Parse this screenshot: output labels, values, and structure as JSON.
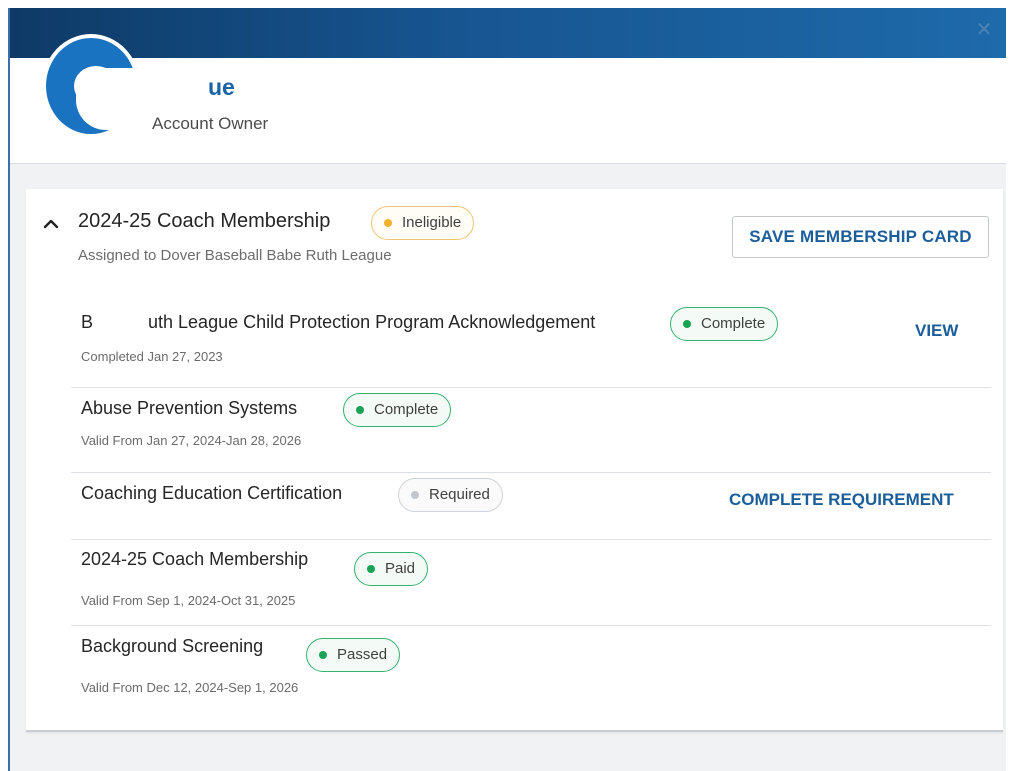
{
  "window": {
    "close_icon": "close-icon"
  },
  "header": {
    "org_name": "ue",
    "role": "Account Owner"
  },
  "membership": {
    "title": "2024-25 Coach Membership",
    "status": "Ineligible",
    "status_color": "#f0b22a",
    "assigned": "Assigned to Dover Baseball Babe Ruth League",
    "save_button": "SAVE MEMBERSHIP CARD"
  },
  "requirements": [
    {
      "title": "B",
      "title_rest": "uth League Child Protection Program Acknowledgement",
      "status": "Complete",
      "detail": "Completed Jan 27, 2023",
      "action": "VIEW"
    },
    {
      "title": "Abuse Prevention Systems",
      "status": "Complete",
      "detail": "Valid From Jan 27, 2024-Jan 28, 2026",
      "action": ""
    },
    {
      "title": "Coaching Education Certification",
      "status": "Required",
      "detail": "",
      "action": "COMPLETE REQUIREMENT"
    },
    {
      "title": "2024-25 Coach Membership",
      "status": "Paid",
      "detail": "Valid From Sep 1, 2024-Oct 31, 2025",
      "action": ""
    },
    {
      "title": "Background Screening",
      "status": "Passed",
      "detail": "Valid From Dec 12, 2024-Sep 1, 2026",
      "action": ""
    }
  ],
  "colors": {
    "accent": "#1c5e9a",
    "success": "#1aa255",
    "warning": "#f0b22a",
    "neutral": "#c3c6ca"
  }
}
